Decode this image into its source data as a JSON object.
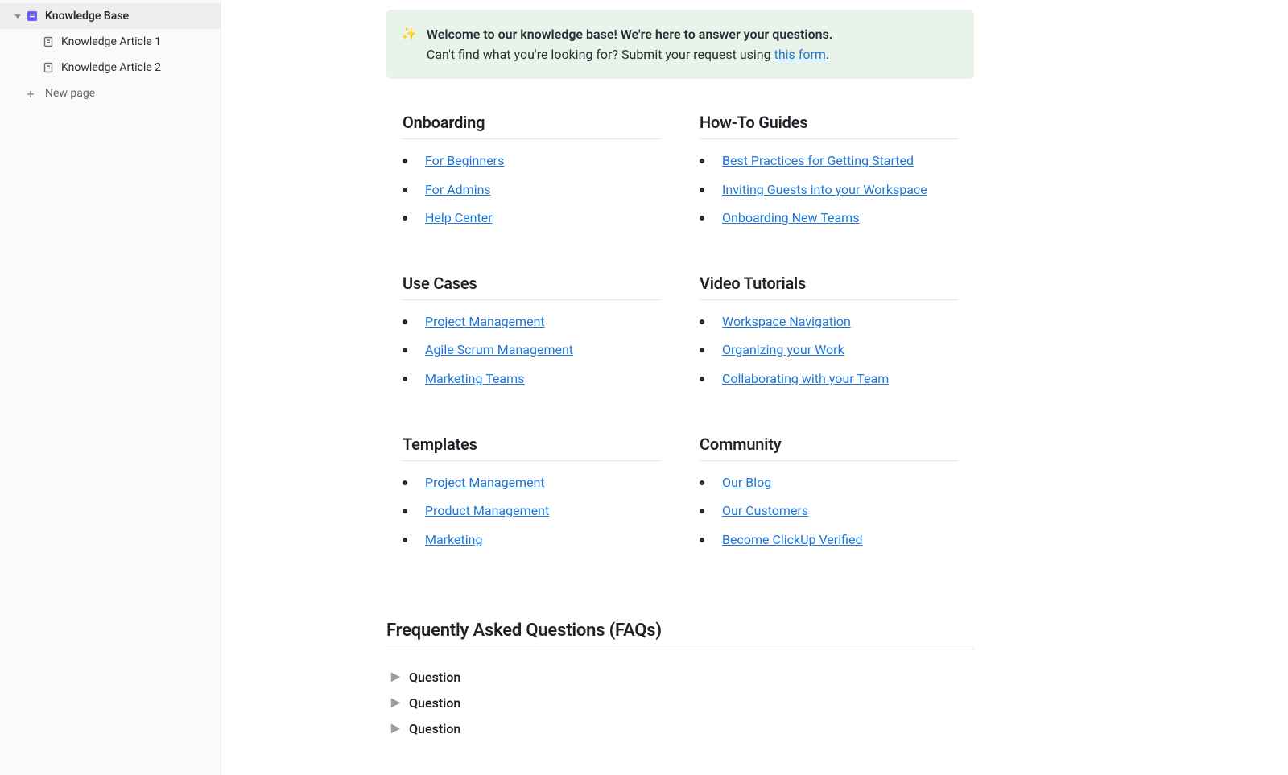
{
  "sidebar": {
    "root": {
      "label": "Knowledge Base"
    },
    "children": [
      {
        "label": "Knowledge Article 1"
      },
      {
        "label": "Knowledge Article 2"
      }
    ],
    "new_page_label": "New page"
  },
  "banner": {
    "emoji": "✨",
    "title": "Welcome to our knowledge base! We're here to answer your questions.",
    "subtitle_before": "Can't find what you're looking for? Submit your request using ",
    "link_text": "this form",
    "after": "."
  },
  "sections": [
    {
      "title": "Onboarding",
      "links": [
        "For Beginners",
        "For Admins",
        "Help Center"
      ]
    },
    {
      "title": "How-To Guides",
      "links": [
        "Best Practices for Getting Started",
        "Inviting Guests into your Workspace",
        "Onboarding New Teams"
      ]
    },
    {
      "title": "Use Cases",
      "links": [
        "Project Management",
        "Agile Scrum Management",
        "Marketing Teams"
      ]
    },
    {
      "title": "Video Tutorials",
      "links": [
        "Workspace Navigation",
        "Organizing your Work",
        "Collaborating with your Team"
      ]
    },
    {
      "title": "Templates",
      "links": [
        "Project Management",
        "Product Management",
        "Marketing"
      ]
    },
    {
      "title": "Community",
      "links": [
        "Our Blog",
        "Our Customers",
        "Become ClickUp Verified"
      ]
    }
  ],
  "faq": {
    "title": "Frequently Asked Questions (FAQs)",
    "items": [
      "Question",
      "Question",
      "Question"
    ]
  }
}
